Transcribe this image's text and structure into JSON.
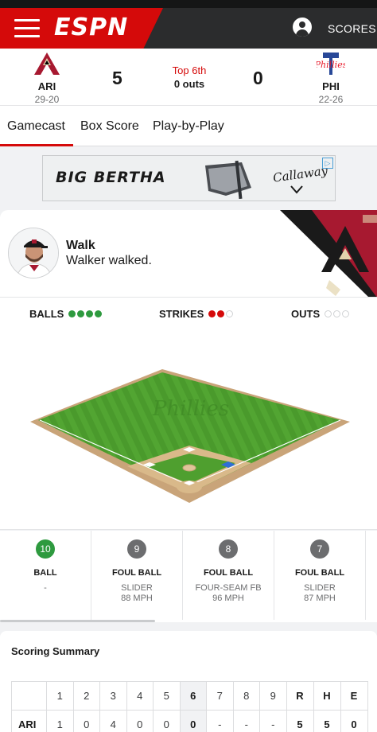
{
  "header": {
    "logo": "ESPN",
    "scores_label": "SCORES",
    "menu_icon": "hamburger-icon",
    "user_icon": "user-icon"
  },
  "game": {
    "away": {
      "abbr": "ARI",
      "record": "29-20",
      "score": "5",
      "color": "#a71930"
    },
    "home": {
      "abbr": "PHI",
      "record": "22-26",
      "score": "0",
      "color": "#e81828"
    },
    "inning": "Top 6th",
    "outs_text": "0 outs"
  },
  "tabs": [
    {
      "label": "Gamecast",
      "active": true
    },
    {
      "label": "Box Score",
      "active": false
    },
    {
      "label": "Play-by-Play",
      "active": false
    }
  ],
  "ad": {
    "headline": "BIG BERTHA",
    "brand": "Callaway",
    "adchoices_icon": "adchoices-icon"
  },
  "play": {
    "title": "Walk",
    "description": "Walker walked."
  },
  "count": {
    "balls_label": "BALLS",
    "balls": 4,
    "balls_max": 4,
    "strikes_label": "STRIKES",
    "strikes": 2,
    "strikes_max": 3,
    "outs_label": "OUTS",
    "outs": 0,
    "outs_max": 3
  },
  "field": {
    "wall_text": "Phillies",
    "runner_on": "first"
  },
  "pitches": [
    {
      "number": "10",
      "result": "BALL",
      "type": "-",
      "speed": "",
      "color": "green"
    },
    {
      "number": "9",
      "result": "FOUL BALL",
      "type": "SLIDER",
      "speed": "88 MPH",
      "color": "gray"
    },
    {
      "number": "8",
      "result": "FOUL BALL",
      "type": "FOUR-SEAM FB",
      "speed": "96 MPH",
      "color": "gray"
    },
    {
      "number": "7",
      "result": "FOUL BALL",
      "type": "SLIDER",
      "speed": "87 MPH",
      "color": "gray"
    }
  ],
  "summary": {
    "title": "Scoring Summary",
    "headers": [
      "1",
      "2",
      "3",
      "4",
      "5",
      "6",
      "7",
      "8",
      "9",
      "R",
      "H",
      "E"
    ],
    "current_inning_index": 5,
    "rows": [
      {
        "team": "ARI",
        "cells": [
          "1",
          "0",
          "4",
          "0",
          "0",
          "0",
          "-",
          "-",
          "-",
          "5",
          "5",
          "0"
        ]
      }
    ]
  }
}
